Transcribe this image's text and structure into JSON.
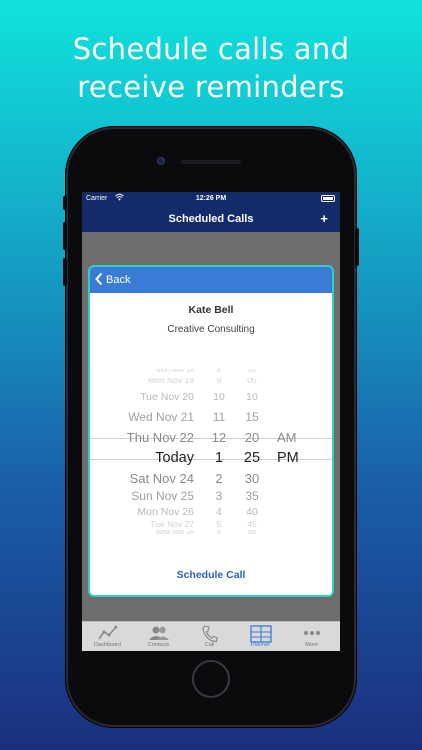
{
  "headline": {
    "line1": "Schedule calls and",
    "line2": "receive reminders"
  },
  "statusbar": {
    "carrier": "Carrier",
    "time": "12:26 PM"
  },
  "navbar": {
    "title": "Scheduled Calls",
    "add_label": "+"
  },
  "modal": {
    "back_label": "Back",
    "contact_name": "Kate Bell",
    "company": "Creative Consulting",
    "schedule_label": "Schedule Call"
  },
  "picker": {
    "rows": [
      {
        "date": "Mon Nov 18",
        "hour": "8",
        "minute": "05",
        "ampm": ""
      },
      {
        "date": "Mon Nov 19",
        "hour": "9",
        "minute": "05",
        "ampm": ""
      },
      {
        "date": "Tue Nov 20",
        "hour": "10",
        "minute": "10",
        "ampm": ""
      },
      {
        "date": "Wed Nov 21",
        "hour": "11",
        "minute": "15",
        "ampm": ""
      },
      {
        "date": "Thu Nov 22",
        "hour": "12",
        "minute": "20",
        "ampm": "AM"
      },
      {
        "date": "Today",
        "hour": "1",
        "minute": "25",
        "ampm": "PM"
      },
      {
        "date": "Sat Nov 24",
        "hour": "2",
        "minute": "30",
        "ampm": ""
      },
      {
        "date": "Sun Nov 25",
        "hour": "3",
        "minute": "35",
        "ampm": ""
      },
      {
        "date": "Mon Nov 26",
        "hour": "4",
        "minute": "40",
        "ampm": ""
      },
      {
        "date": "Tue Nov 27",
        "hour": "5",
        "minute": "45",
        "ampm": ""
      },
      {
        "date": "Wed Nov 28",
        "hour": "6",
        "minute": "50",
        "ampm": ""
      }
    ]
  },
  "tabs": [
    {
      "label": "Dashboard",
      "icon": "dashboard-icon",
      "active": false
    },
    {
      "label": "Contacts",
      "icon": "contacts-icon",
      "active": false
    },
    {
      "label": "Call",
      "icon": "phone-icon",
      "active": false
    },
    {
      "label": "Planner",
      "icon": "planner-icon",
      "active": true
    },
    {
      "label": "More",
      "icon": "more-icon",
      "active": false
    }
  ],
  "colors": {
    "navbar": "#132a6b",
    "modal_header": "#3a7bd5",
    "modal_border": "#2ecfc8",
    "accent_text": "#2a62b5"
  }
}
